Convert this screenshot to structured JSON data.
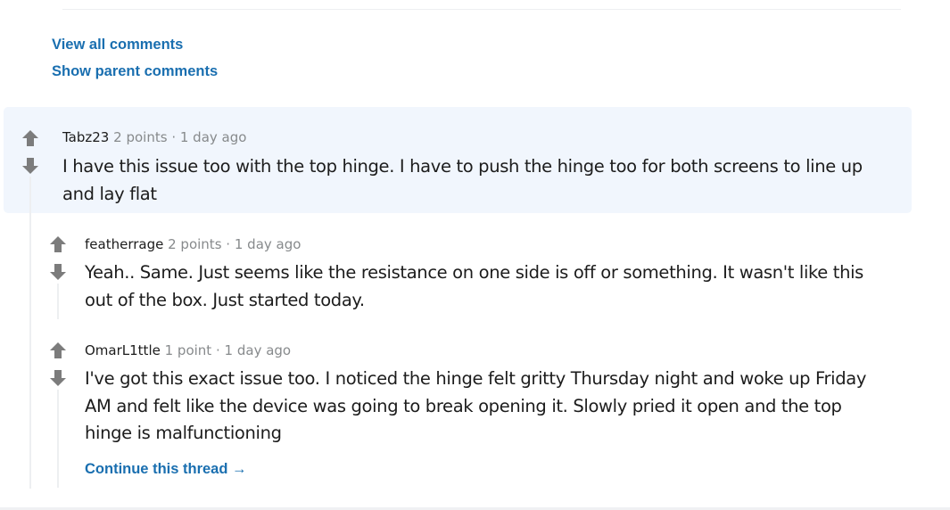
{
  "links": {
    "view_all": "View all comments",
    "show_parent": "Show parent comments"
  },
  "colors": {
    "link": "#1a6fb0",
    "highlight_bg": "#f1f6fd",
    "muted": "#878a8c",
    "vote_arrow": "#7c7c7c"
  },
  "comments": [
    {
      "author": "Tabz23",
      "points": "2 points",
      "separator": "·",
      "time": "1 day ago",
      "body_line1": "I have this issue too with the top hinge. I have to push the hinge too for both screens to line up",
      "body_line2": "and lay flat",
      "highlighted": true
    },
    {
      "author": "featherrage",
      "points": "2 points",
      "separator": "·",
      "time": "1 day ago",
      "body_line1": "Yeah.. Same. Just seems like the resistance on one side is off or something. It wasn't like this",
      "body_line2": "out of the box. Just started today."
    },
    {
      "author": "OmarL1ttle",
      "points": "1 point",
      "separator": "·",
      "time": "1 day ago",
      "body_line1": "I've got this exact issue too. I noticed the hinge felt gritty Thursday night and woke up Friday",
      "body_line2": "AM and felt like the device was going to break opening it. Slowly pried it open and the top",
      "body_line3": "hinge is malfunctioning"
    }
  ],
  "continue_thread": {
    "label": "Continue this thread",
    "icon": "→"
  }
}
